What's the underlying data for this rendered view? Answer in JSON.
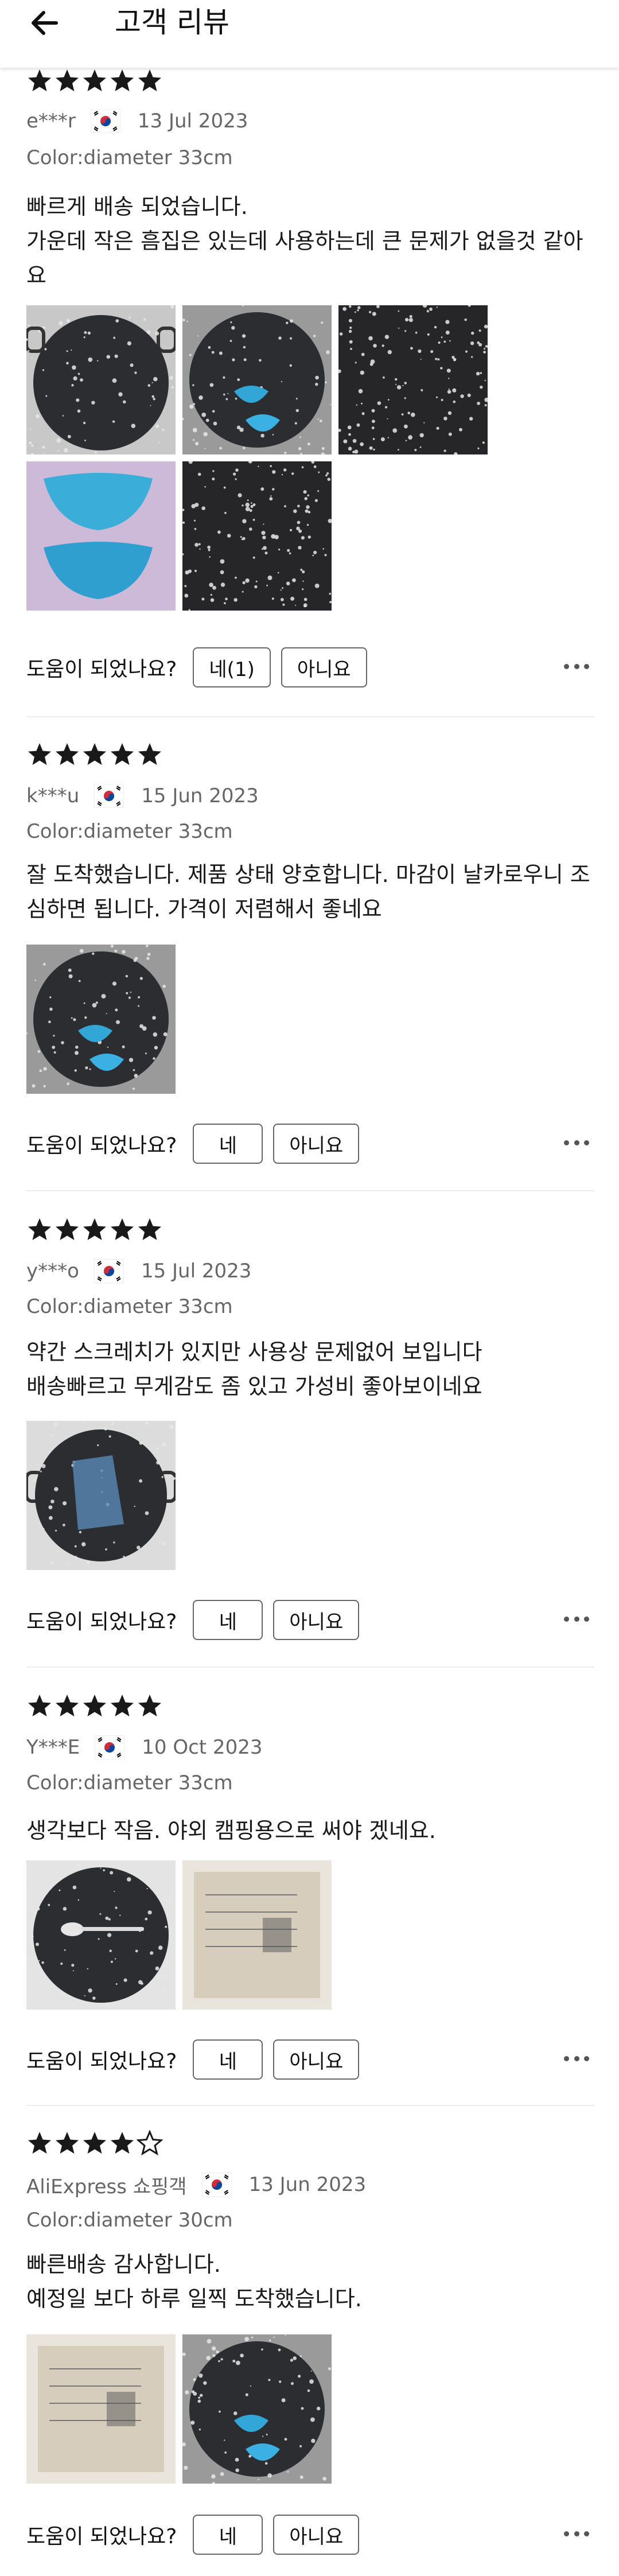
{
  "header": {
    "title": "고객 리뷰",
    "back_icon": "arrow-left-icon"
  },
  "helpful_question": "도움이 되었나요?",
  "reviews": [
    {
      "rating": 5,
      "user": "e***r",
      "country_flag": "south-korea-flag-icon",
      "date": "13 Jul 2023",
      "variant": "Color:diameter 33cm",
      "text": "빠르게 배송 되었습니다.\n가운데 작은 흠집은 있는데 사용하는데 큰 문제가 없을것 같아요",
      "photos": [
        "grill-pan-photo",
        "pan-with-blue-handles-photo",
        "speckled-surface-closeup-photo",
        "blue-silicone-handles-photo",
        "speckled-surface-closeup-photo"
      ],
      "yes_label": "네(1)",
      "no_label": "아니요"
    },
    {
      "rating": 5,
      "user": "k***u",
      "country_flag": "south-korea-flag-icon",
      "date": "15 Jun 2023",
      "variant": "Color:diameter 33cm",
      "text": "잘 도착했습니다.  제품 상태 양호합니다.  마감이 날카로우니 조심하면 됩니다. 가격이 저렴해서 좋네요",
      "photos": [
        "pan-with-blue-handles-photo"
      ],
      "yes_label": "네",
      "no_label": "아니요"
    },
    {
      "rating": 5,
      "user": "y***o",
      "country_flag": "south-korea-flag-icon",
      "date": "15 Jul 2023",
      "variant": "Color:diameter 33cm",
      "text": "약간 스크레치가 있지만 사용상 문제없어 보입니다\n배송빠르고 무게감도 좀 있고 가성비 좋아보이네요",
      "photos": [
        "pan-in-bag-photo"
      ],
      "yes_label": "네",
      "no_label": "아니요"
    },
    {
      "rating": 5,
      "user": "Y***E",
      "country_flag": "south-korea-flag-icon",
      "date": "10 Oct 2023",
      "variant": "Color:diameter 33cm",
      "text": "생각보다 작음. 야외 캠핑용으로 써야 겠네요.",
      "photos": [
        "pan-with-spoon-photo",
        "product-box-photo"
      ],
      "yes_label": "네",
      "no_label": "아니요"
    },
    {
      "rating": 4,
      "user": "AliExpress 쇼핑객",
      "country_flag": "south-korea-flag-icon",
      "date": "13 Jun 2023",
      "variant": "Color:diameter 30cm",
      "text": "빠른배송 감사합니다.\n예정일 보다 하루 일찍 도착했습니다.",
      "photos": [
        "product-box-photo",
        "pan-with-blue-handles-photo"
      ],
      "yes_label": "네",
      "no_label": "아니요"
    }
  ]
}
